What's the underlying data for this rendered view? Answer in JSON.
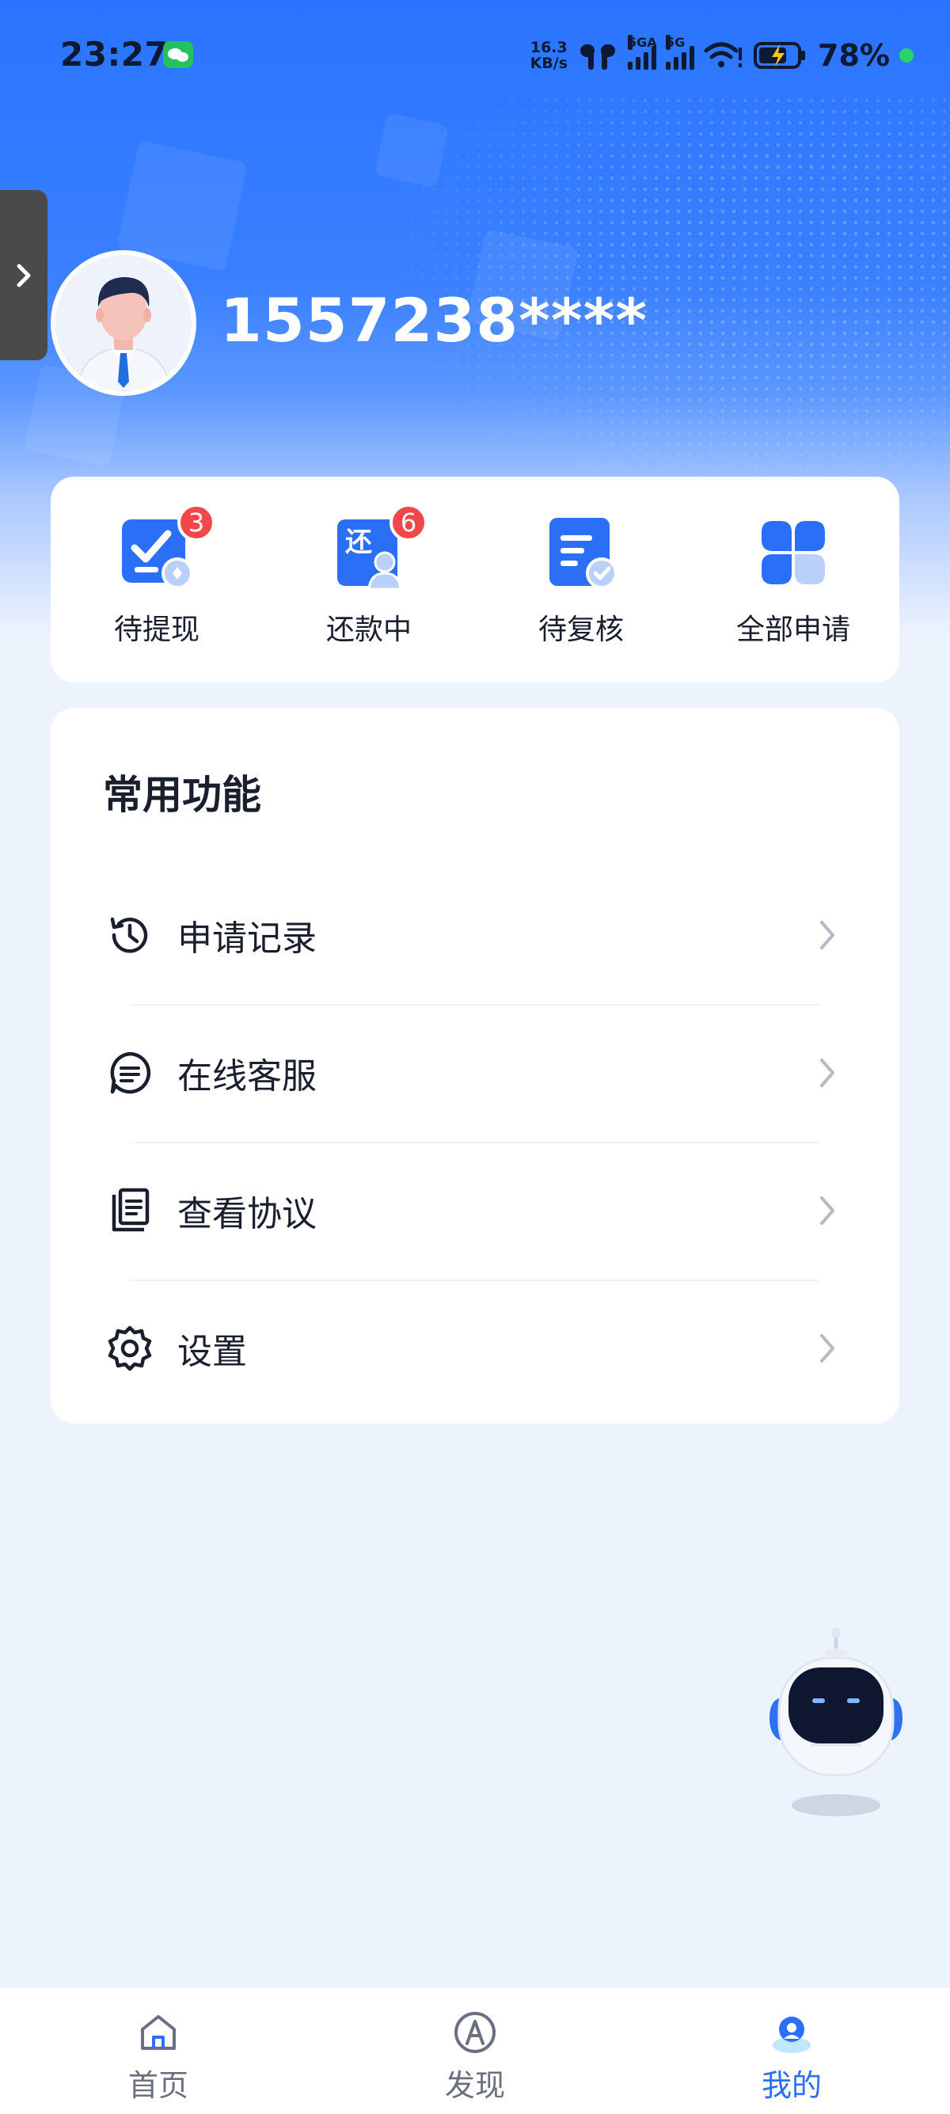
{
  "status_bar": {
    "time": "23:27",
    "net_speed_value": "16.3",
    "net_speed_unit": "KB/s",
    "sim1_label": "5GA",
    "sim2_label": "5G",
    "battery": "78%",
    "icons": [
      "wechat-icon",
      "earbuds-icon",
      "signal-icon",
      "wifi-icon",
      "battery-charging-icon"
    ]
  },
  "profile": {
    "phone": "1557238****"
  },
  "quick_actions": [
    {
      "label": "待提现",
      "badge": "3",
      "icon": "withdraw-icon"
    },
    {
      "label": "还款中",
      "badge": "6",
      "icon": "repay-icon"
    },
    {
      "label": "待复核",
      "badge": "",
      "icon": "review-icon"
    },
    {
      "label": "全部申请",
      "badge": "",
      "icon": "all-apps-icon"
    }
  ],
  "functions": {
    "title": "常用功能",
    "items": [
      {
        "label": "申请记录",
        "icon": "history-icon"
      },
      {
        "label": "在线客服",
        "icon": "chat-icon"
      },
      {
        "label": "查看协议",
        "icon": "document-icon"
      },
      {
        "label": "设置",
        "icon": "gear-icon"
      }
    ]
  },
  "bottom_nav": [
    {
      "label": "首页",
      "icon": "home-icon",
      "active": false
    },
    {
      "label": "发现",
      "icon": "compass-icon",
      "active": false
    },
    {
      "label": "我的",
      "icon": "profile-icon",
      "active": true
    }
  ],
  "colors": {
    "brand": "#2a6ff5",
    "badge": "#f2474a",
    "background": "#edf3fc"
  }
}
